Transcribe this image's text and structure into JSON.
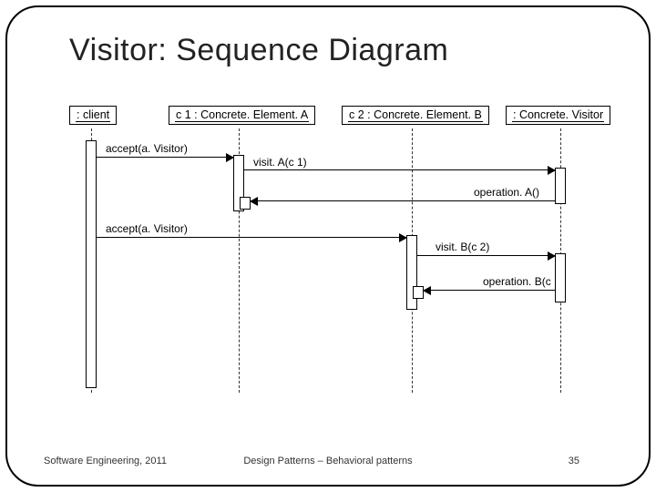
{
  "slide": {
    "title": "Visitor: Sequence Diagram",
    "footer_left": "Software Engineering, 2011",
    "footer_center": "Design Patterns – Behavioral patterns",
    "footer_right": "35"
  },
  "participants": {
    "client": ": client",
    "c1": "c 1 : Concrete. Element. A",
    "c2": "c 2 : Concrete. Element. B",
    "visitor": ": Concrete. Visitor"
  },
  "messages": {
    "accept1": "accept(a. Visitor)",
    "visitA": "visit. A(c 1)",
    "opA": "operation. A()",
    "accept2": "accept(a. Visitor)",
    "visitB": "visit. B(c 2)",
    "opB": "operation. B(c"
  }
}
